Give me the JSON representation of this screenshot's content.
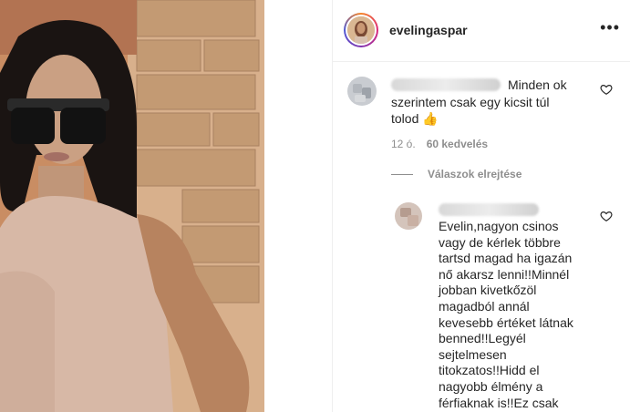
{
  "post": {
    "username": "evelingaspar",
    "more_icon": "more-horizontal-icon"
  },
  "comments": [
    {
      "text_lines": [
        "Minden ok",
        "szerintem csak egy kicsit túl",
        "tolod 👍"
      ],
      "time": "12 ó.",
      "likes": "60 kedvelés",
      "like_icon": "heart-icon"
    }
  ],
  "replies_toggle": "Válaszok elrejtése",
  "reply": {
    "text_lines": [
      "Evelin,nagyon csinos",
      "vagy de kérlek többre",
      "tartsd magad ha igazán",
      "nő akarsz lenni!!Minnél",
      "jobban kivetkőzöl",
      "magadból annál",
      "kevesebb értéket látnak",
      "benned!!Legyél",
      "sejtelmesen",
      "titokzatos!!Hidd el",
      "nagyobb élmény a",
      "férfiaknak is!!Ez csak"
    ],
    "like_icon": "heart-icon"
  }
}
